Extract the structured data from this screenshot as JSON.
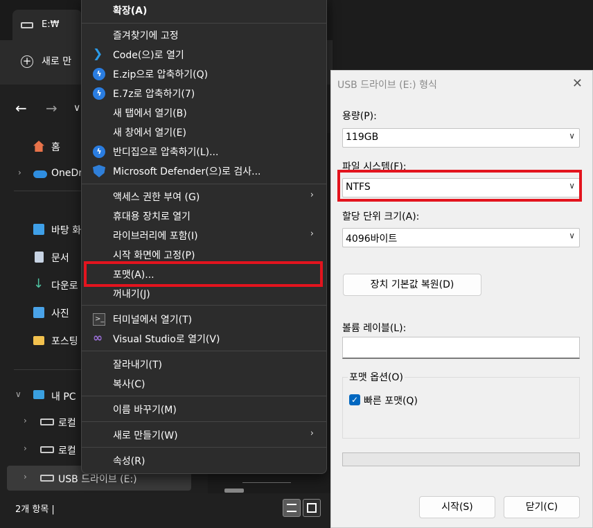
{
  "explorer": {
    "tab_title": "E:₩",
    "new_label": "새로 만",
    "sidebar": {
      "home": "홈",
      "onedrive": "OneDr",
      "desktop": "바탕 화",
      "documents": "문서",
      "downloads": "다운로",
      "pictures": "사진",
      "folder": "포스팅",
      "thispc": "내 PC",
      "local1": "로컬",
      "local2": "로컬",
      "usb": "USB 드라이브 (E:)"
    },
    "status": "2개 항목  |"
  },
  "context_menu": {
    "items": [
      {
        "label": "확장(A)",
        "icon": ""
      },
      {
        "label": "즐겨찾기에 고정",
        "icon": ""
      },
      {
        "label": "Code(으)로 열기",
        "icon": "vscode-icon"
      },
      {
        "label": "E.zip으로 압축하기(Q)",
        "icon": "bandizip-icon"
      },
      {
        "label": "E.7z로 압축하기(7)",
        "icon": "bandizip-icon"
      },
      {
        "label": "새 탭에서 열기(B)",
        "icon": ""
      },
      {
        "label": "새 창에서 열기(E)",
        "icon": ""
      },
      {
        "label": "반디집으로 압축하기(L)...",
        "icon": "bandizip-icon"
      },
      {
        "label": "Microsoft Defender(으)로 검사...",
        "icon": "defender-shield-icon"
      },
      {
        "label": "액세스 권한 부여 (G)",
        "icon": "",
        "submenu": true
      },
      {
        "label": "휴대용 장치로 열기",
        "icon": ""
      },
      {
        "label": "라이브러리에 포함(I)",
        "icon": "",
        "submenu": true
      },
      {
        "label": "시작 화면에 고정(P)",
        "icon": ""
      },
      {
        "label": "포맷(A)...",
        "icon": ""
      },
      {
        "label": "꺼내기(J)",
        "icon": ""
      },
      {
        "label": "터미널에서 열기(T)",
        "icon": "terminal-icon"
      },
      {
        "label": "Visual Studio로 열기(V)",
        "icon": "visual-studio-icon"
      },
      {
        "label": "잘라내기(T)",
        "icon": ""
      },
      {
        "label": "복사(C)",
        "icon": ""
      },
      {
        "label": "이름 바꾸기(M)",
        "icon": ""
      },
      {
        "label": "새로 만들기(W)",
        "icon": "",
        "submenu": true
      },
      {
        "label": "속성(R)",
        "icon": ""
      }
    ]
  },
  "format_dialog": {
    "title": "USB 드라이브 (E:) 형식",
    "capacity_label": "용량(P):",
    "capacity_value": "119GB",
    "fs_label": "파일 시스템(F):",
    "fs_value": "NTFS",
    "alloc_label": "할당 단위 크기(A):",
    "alloc_value": "4096바이트",
    "restore_button": "장치 기본값 복원(D)",
    "volume_label": "볼륨 레이블(L):",
    "volume_value": "",
    "options_group": "포맷 옵션(O)",
    "quick_format": "빠른 포맷(Q)",
    "quick_format_checked": true,
    "progress": 0,
    "start_button": "시작(S)",
    "close_button": "닫기(C)"
  },
  "colors": {
    "highlight": "#e3141e",
    "accent": "#0067c0"
  }
}
